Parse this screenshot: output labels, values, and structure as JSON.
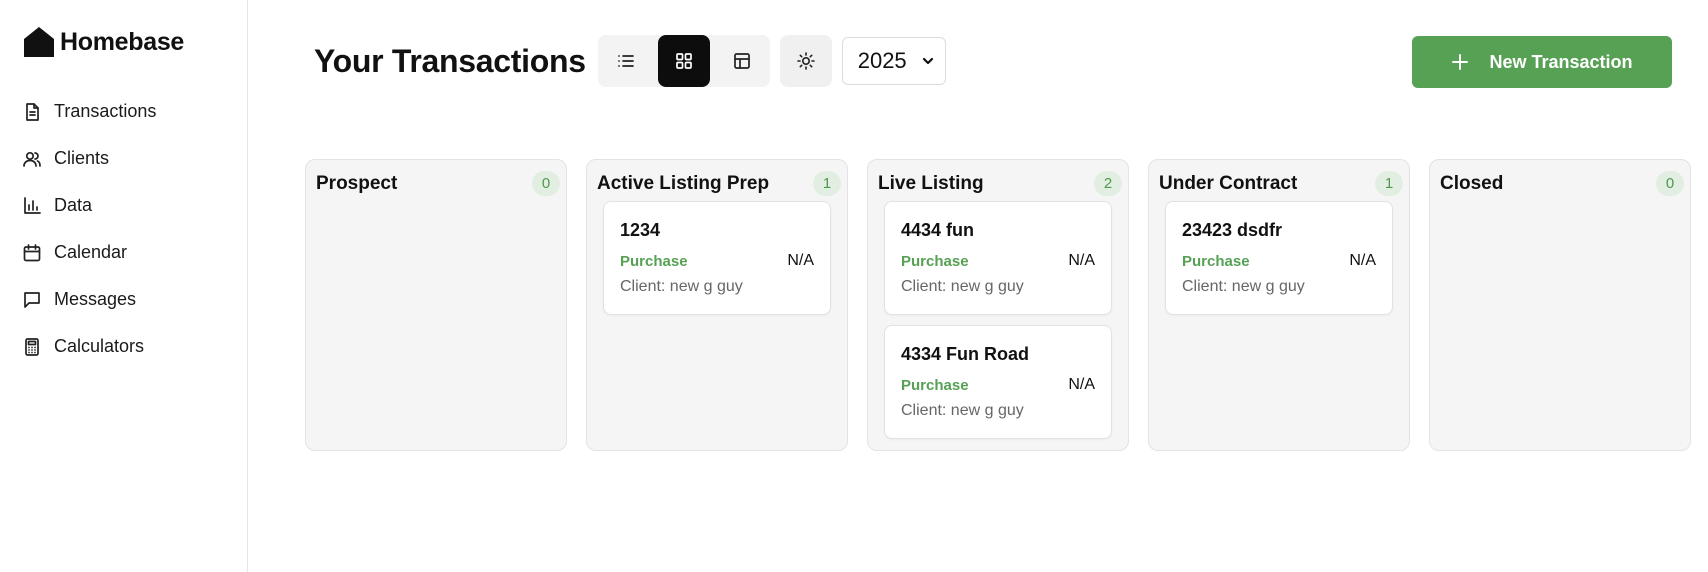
{
  "app": {
    "name": "Homebase"
  },
  "sidebar": {
    "items": [
      {
        "label": "Transactions",
        "icon": "document-icon"
      },
      {
        "label": "Clients",
        "icon": "users-icon"
      },
      {
        "label": "Data",
        "icon": "bar-chart-icon"
      },
      {
        "label": "Calendar",
        "icon": "calendar-icon"
      },
      {
        "label": "Messages",
        "icon": "message-icon"
      },
      {
        "label": "Calculators",
        "icon": "calculator-icon"
      }
    ]
  },
  "header": {
    "title": "Your Transactions",
    "views": [
      "list",
      "board",
      "table"
    ],
    "active_view": "board",
    "year": "2025",
    "new_button_label": "New Transaction"
  },
  "colors": {
    "accent": "#57a155",
    "badge_bg": "#e3eee2",
    "active_view_bg": "#0d0d0d"
  },
  "board": {
    "columns": [
      {
        "title": "Prospect",
        "count": "0",
        "cards": []
      },
      {
        "title": "Active Listing Prep",
        "count": "1",
        "cards": [
          {
            "title": "1234",
            "type": "Purchase",
            "price": "N/A",
            "client": "Client: new g guy"
          }
        ]
      },
      {
        "title": "Live Listing",
        "count": "2",
        "cards": [
          {
            "title": "4434 fun",
            "type": "Purchase",
            "price": "N/A",
            "client": "Client: new g guy"
          },
          {
            "title": "4334 Fun Road",
            "type": "Purchase",
            "price": "N/A",
            "client": "Client: new g guy"
          }
        ]
      },
      {
        "title": "Under Contract",
        "count": "1",
        "cards": [
          {
            "title": "23423 dsdfr",
            "type": "Purchase",
            "price": "N/A",
            "client": "Client: new g guy"
          }
        ]
      },
      {
        "title": "Closed",
        "count": "0",
        "cards": []
      }
    ]
  }
}
